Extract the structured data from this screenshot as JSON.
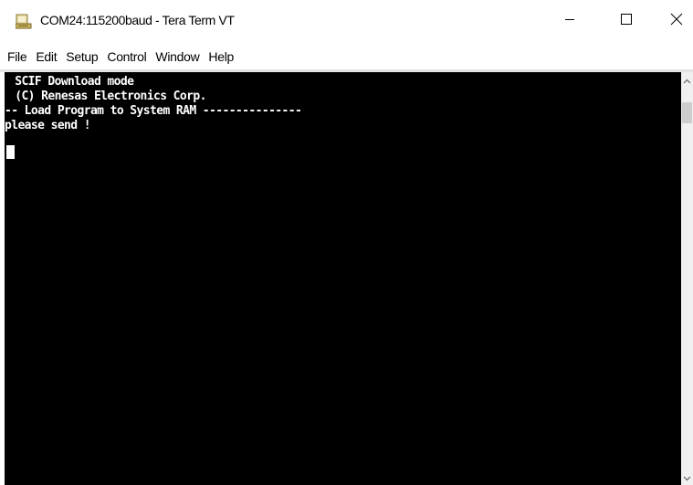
{
  "window": {
    "title": "COM24:115200baud - Tera Term VT",
    "app_icon": "tera-term-icon",
    "buttons": {
      "minimize_icon": "minimize-icon",
      "maximize_icon": "maximize-icon",
      "close_icon": "close-icon"
    }
  },
  "menu": {
    "items": [
      "File",
      "Edit",
      "Setup",
      "Control",
      "Window",
      "Help"
    ]
  },
  "terminal": {
    "lines": [
      " SCIF Download mode",
      " (C) Renesas Electronics Corp.",
      "-- Load Program to System RAM ---------------",
      "please send !"
    ],
    "background": "#000000",
    "foreground": "#ffffff"
  },
  "scrollbar": {
    "up_icon": "scroll-up-arrow-icon",
    "down_icon": "scroll-down-arrow-icon"
  }
}
